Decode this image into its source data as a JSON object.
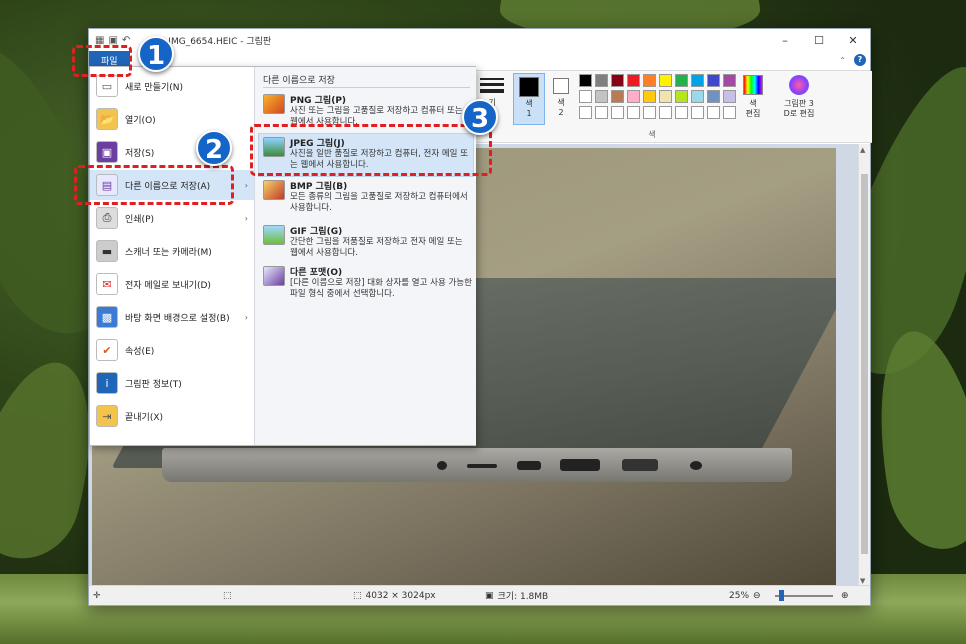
{
  "window": {
    "title": "IMG_6654.HEIC - 그림판",
    "controls": [
      "–",
      "☐",
      "✕"
    ]
  },
  "ribbon": {
    "file_tab": "파일",
    "color1": "색\n1",
    "color2": "색\n2",
    "color_edit": "색\n편집",
    "paint3d": "그림판 3\nD로 편집",
    "size_label": "기",
    "group_color": "색"
  },
  "file_menu": {
    "items": [
      {
        "label": "새로 만들기(N)",
        "icon": "new-file-icon"
      },
      {
        "label": "열기(O)",
        "icon": "open-folder-icon"
      },
      {
        "label": "저장(S)",
        "icon": "save-disk-icon"
      },
      {
        "label": "다른 이름으로 저장(A)",
        "icon": "save-as-icon",
        "has_submenu": true
      },
      {
        "label": "인쇄(P)",
        "icon": "printer-icon",
        "has_submenu": true
      },
      {
        "label": "스캐너 또는 카메라(M)",
        "icon": "scanner-icon"
      },
      {
        "label": "전자 메일로 보내기(D)",
        "icon": "email-icon"
      },
      {
        "label": "바탕 화면 배경으로 설정(B)",
        "icon": "desktop-background-icon",
        "has_submenu": true
      },
      {
        "label": "속성(E)",
        "icon": "properties-check-icon"
      },
      {
        "label": "그림판 정보(T)",
        "icon": "info-icon"
      },
      {
        "label": "끝내기(X)",
        "icon": "exit-icon"
      }
    ],
    "chevron": "›"
  },
  "save_as_panel": {
    "heading": "다른 이름으로 저장",
    "options": [
      {
        "title": "PNG 그림(P)",
        "desc": "사진 또는 그림을 고품질로 저장하고 컴퓨터 또는 웹에서 사용합니다.",
        "icon": "png-image-icon"
      },
      {
        "title": "JPEG 그림(J)",
        "desc": "사진을 일반 품질로 저장하고 컴퓨터, 전자 메일 또는 웹에서 사용합니다.",
        "icon": "jpeg-image-icon"
      },
      {
        "title": "BMP 그림(B)",
        "desc": "모든 종류의 그림을 고품질로 저장하고 컴퓨터에서 사용합니다.",
        "icon": "bmp-image-icon"
      },
      {
        "title": "GIF 그림(G)",
        "desc": "간단한 그림을 저품질로 저장하고 전자 메일 또는 웹에서 사용합니다.",
        "icon": "gif-image-icon"
      },
      {
        "title": "다른 포맷(O)",
        "desc": "[다른 이름으로 저장] 대화 상자를 열고 사용 가능한 파일 형식 중에서 선택합니다.",
        "icon": "other-format-icon"
      }
    ]
  },
  "statusbar": {
    "dimensions": "4032 × 3024px",
    "size": "크기: 1.8MB",
    "zoom": "25%",
    "zoom_level": 0.25
  },
  "annotations": {
    "badge1": "1",
    "badge2": "2",
    "badge3": "3"
  },
  "colors": {
    "accent": "#1f65b8",
    "annotation_red": "#e02020",
    "badge_blue": "#1565c8",
    "palette_row1": [
      "#000000",
      "#7f7f7f",
      "#880015",
      "#ed1c24",
      "#ff7f27",
      "#fff200",
      "#22b14c",
      "#00a2e8",
      "#3f48cc",
      "#a349a4"
    ],
    "palette_row2": [
      "#ffffff",
      "#c3c3c3",
      "#b97a57",
      "#ffaec9",
      "#ffc90e",
      "#efe4b0",
      "#b5e61d",
      "#99d9ea",
      "#7092be",
      "#c8bfe7"
    ]
  }
}
